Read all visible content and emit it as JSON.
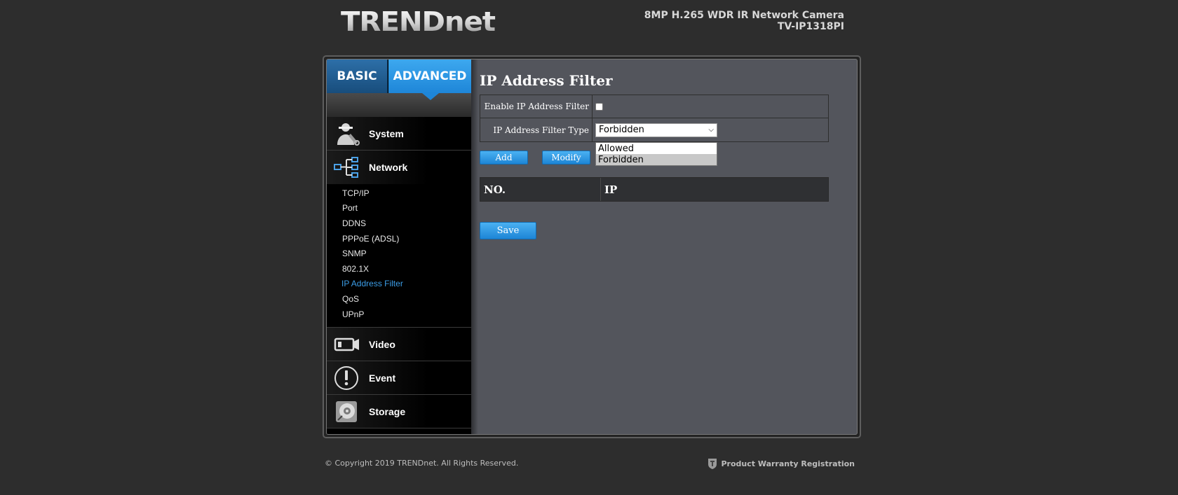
{
  "header": {
    "logo_text": "TRENDnet",
    "model_name": "8MP H.265 WDR IR Network Camera",
    "model_number": "TV-IP1318PI"
  },
  "tabs": {
    "basic": "BASIC",
    "advanced": "ADVANCED",
    "active": "ADVANCED"
  },
  "sidebar": {
    "categories": [
      {
        "label": "System",
        "icon": "technician-icon"
      },
      {
        "label": "Network",
        "icon": "network-tree-icon"
      },
      {
        "label": "Video",
        "icon": "video-camera-icon"
      },
      {
        "label": "Event",
        "icon": "exclamation-icon"
      },
      {
        "label": "Storage",
        "icon": "hard-disk-icon"
      }
    ],
    "network_items": [
      "TCP/IP",
      "Port",
      "DDNS",
      "PPPoE (ADSL)",
      "SNMP",
      "802.1X",
      "IP Address Filter",
      "QoS",
      "UPnP"
    ],
    "active_item": "IP Address Filter"
  },
  "main": {
    "title": "IP Address Filter",
    "enable_label": "Enable IP Address Filter",
    "enable_checked": false,
    "type_label": "IP Address Filter Type",
    "type_value": "Forbidden",
    "type_options": [
      "Allowed",
      "Forbidden"
    ],
    "add_label": "Add",
    "modify_label": "Modify",
    "table_headers": [
      "NO.",
      "IP"
    ],
    "save_label": "Save"
  },
  "footer": {
    "copyright": "© Copyright 2019 TRENDnet. All Rights Reserved.",
    "warranty": "Product Warranty Registration"
  },
  "colors": {
    "accent": "#1e86d8",
    "active_link": "#3c9ee8",
    "background": "#2d2d2d",
    "content_bg": "#53555c"
  }
}
